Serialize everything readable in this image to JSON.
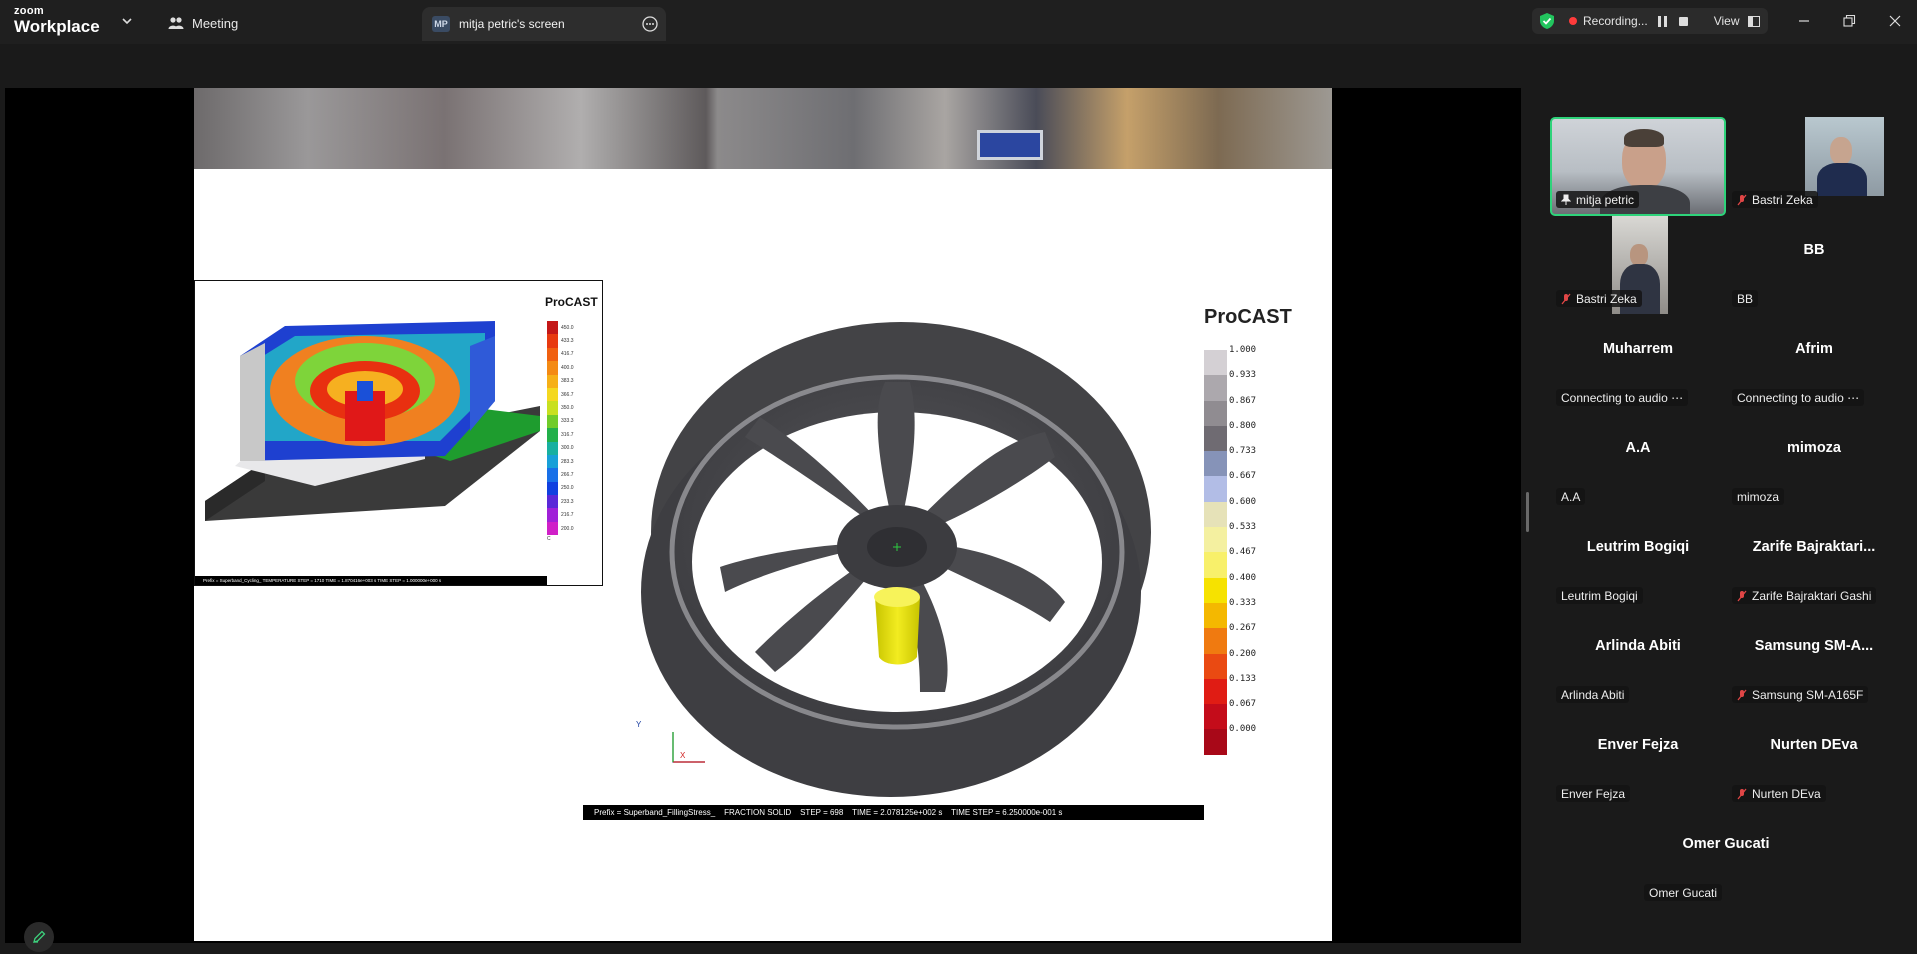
{
  "app": {
    "logo_line1": "zoom",
    "logo_line2": "Workplace"
  },
  "tabs": {
    "meeting_label": "Meeting",
    "screen_badge": "MP",
    "screen_label": "mitja petric's screen"
  },
  "recording": {
    "status_label": "Recording...",
    "view_label": "View",
    "status_color": "#ff3b3b",
    "shield_color": "#22c55e"
  },
  "slide": {
    "inset_title": "ProCAST",
    "inset_legend_values": [
      "450.0",
      "433.3",
      "416.7",
      "400.0",
      "383.3",
      "366.7",
      "350.0",
      "333.3",
      "316.7",
      "300.0",
      "283.3",
      "266.7",
      "250.0",
      "233.3",
      "216.7",
      "200.0"
    ],
    "inset_legend_unit": "C",
    "inset_status_text": "Prefix = Superband_Cycling_   TEMPERATURE   STEP = 1710   TIME = 1.870416e+003 s   TIME STEP = 1.000000e+000 s",
    "main_title": "ProCAST",
    "main_legend_values": [
      "1.000",
      "0.933",
      "0.867",
      "0.800",
      "0.733",
      "0.667",
      "0.600",
      "0.533",
      "0.467",
      "0.400",
      "0.333",
      "0.267",
      "0.200",
      "0.133",
      "0.067",
      "0.000"
    ],
    "main_legend_colors": [
      "#d4d0d4",
      "#aca8ad",
      "#908c91",
      "#6f6b72",
      "#8693b8",
      "#b2bde6",
      "#e6e2b8",
      "#f4f0a0",
      "#f8f06a",
      "#f6e200",
      "#f4b800",
      "#f07a10",
      "#ea4a12",
      "#e01c14",
      "#c40c1a",
      "#a80818"
    ],
    "axis_y": "Y",
    "axis_x": "X",
    "status_prefix": "Prefix = Superband_FillingStress_",
    "status_field": "FRACTION SOLID",
    "status_step": "STEP = 698",
    "status_time": "TIME = 2.078125e+002 s",
    "status_timestep": "TIME STEP = 6.250000e-001 s"
  },
  "participants": [
    {
      "id": "mitja",
      "tag": "mitja petric",
      "pinned": true,
      "muted": false,
      "video": true,
      "active": true
    },
    {
      "id": "bastri1",
      "tag": "Bastri Zeka",
      "muted": true,
      "video": true
    },
    {
      "id": "bastri2",
      "tag": "Bastri Zeka",
      "muted": true,
      "video": true
    },
    {
      "id": "bb",
      "name": "BB",
      "tag": "BB",
      "muted": false
    },
    {
      "id": "muharrem",
      "name": "Muharrem",
      "tag": "Connecting to audio ⋯",
      "muted": false
    },
    {
      "id": "afrim",
      "name": "Afrim",
      "tag": "Connecting to audio ⋯",
      "muted": false
    },
    {
      "id": "aa",
      "name": "A.A",
      "tag": "A.A",
      "muted": false
    },
    {
      "id": "mimoza",
      "name": "mimoza",
      "tag": "mimoza",
      "muted": false
    },
    {
      "id": "leutrim",
      "name": "Leutrim Bogiqi",
      "tag": "Leutrim Bogiqi",
      "muted": false
    },
    {
      "id": "zarife",
      "name": "Zarife  Bajraktari...",
      "tag": "Zarife Bajraktari Gashi",
      "muted": true
    },
    {
      "id": "arlinda",
      "name": "Arlinda Abiti",
      "tag": "Arlinda Abiti",
      "muted": false
    },
    {
      "id": "samsung",
      "name": "Samsung  SM-A...",
      "tag": "Samsung SM-A165F",
      "muted": true
    },
    {
      "id": "enver",
      "name": "Enver Fejza",
      "tag": "Enver Fejza",
      "muted": false
    },
    {
      "id": "nurten",
      "name": "Nurten DEva",
      "tag": "Nurten DEva",
      "muted": true
    },
    {
      "id": "omer",
      "name": "Omer Gucati",
      "tag": "Omer Gucati",
      "muted": false
    }
  ]
}
